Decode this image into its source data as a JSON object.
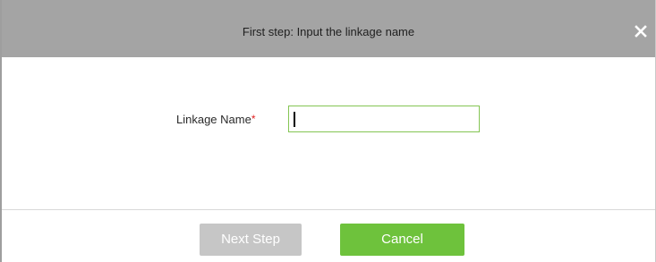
{
  "dialog": {
    "title": "First step: Input the linkage name",
    "close_icon": "close-icon",
    "colors": {
      "titlebar": "#a4a4a4",
      "accent_green": "#6ec23c",
      "disabled_gray": "#c6c6c6",
      "required_red": "#e02020"
    }
  },
  "form": {
    "linkage_name_label": "Linkage Name",
    "required_marker": "*",
    "linkage_name_value": ""
  },
  "buttons": {
    "next_step_label": "Next Step",
    "cancel_label": "Cancel"
  }
}
